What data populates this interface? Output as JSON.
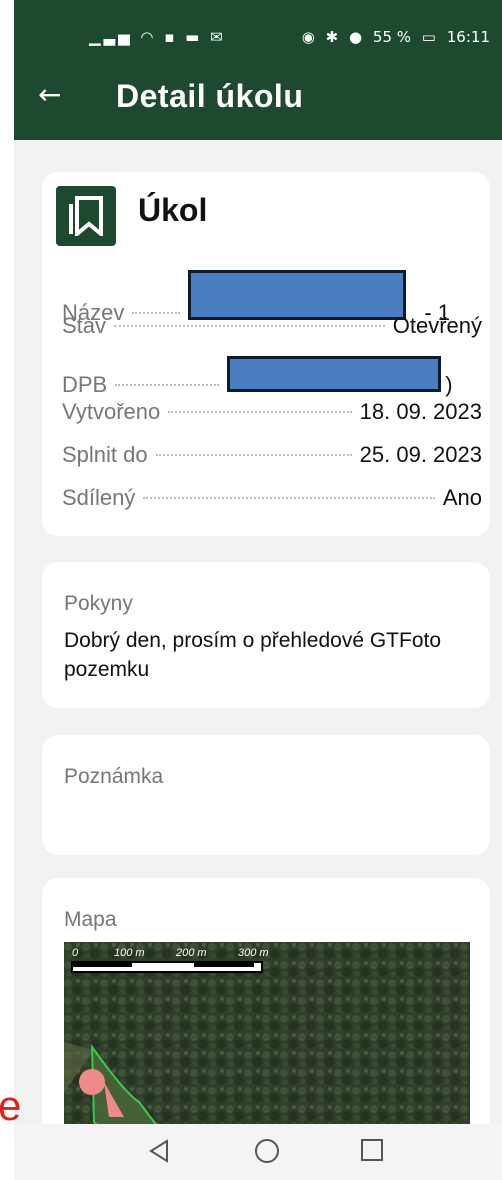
{
  "status_bar": {
    "left_icons": "signal-wifi-notification-icons",
    "battery_percent": "55 %",
    "time": "16:11"
  },
  "app_bar": {
    "back_icon": "arrow-left-icon",
    "title": "Detail úkolu"
  },
  "task_card": {
    "icon": "bookmark-icon",
    "title": "Úkol",
    "rows": [
      {
        "label": "Název",
        "value_suffix": "- 1",
        "redacted": true
      },
      {
        "label": "Stav",
        "value": "Otevřený"
      },
      {
        "label": "DPB",
        "value_suffix": ")",
        "redacted": true
      },
      {
        "label": "Vytvořeno",
        "value": "18. 09. 2023"
      },
      {
        "label": "Splnit do",
        "value": "25. 09. 2023"
      },
      {
        "label": "Sdílený",
        "value": "Ano"
      }
    ]
  },
  "instructions": {
    "label": "Pokyny",
    "text": "Dobrý den, prosím o přehledové GTFoto pozemku"
  },
  "note": {
    "label": "Poznámka",
    "text": ""
  },
  "map": {
    "label": "Mapa",
    "scale_labels": [
      "0",
      "100 m",
      "200 m",
      "300 m"
    ]
  },
  "overlay_letter": "e",
  "nav_bar": {
    "back": "triangle-back-icon",
    "home": "circle-home-icon",
    "recent": "square-recent-icon"
  },
  "colors": {
    "app_bar": "#1d4a2f",
    "redaction": "#4a7ec0",
    "overlay_text": "#e0201b"
  }
}
